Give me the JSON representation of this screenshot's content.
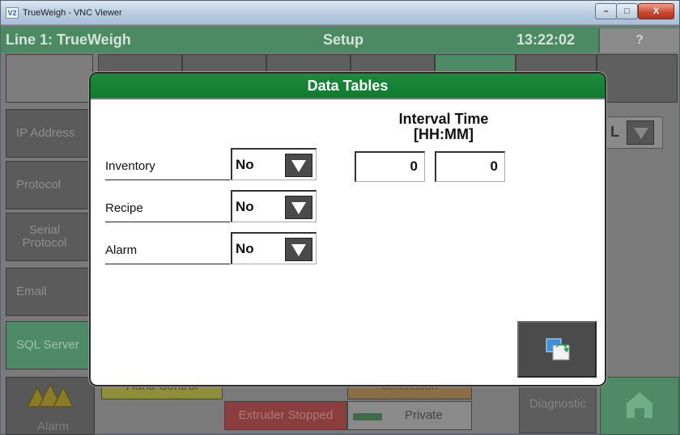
{
  "window": {
    "title": "TrueWeigh - VNC Viewer",
    "logo_text": "V2",
    "controls": {
      "minimize": "–",
      "maximize": "□",
      "close": "X"
    }
  },
  "header": {
    "line_title": "Line 1: TrueWeigh",
    "screen_title": "Setup",
    "time": "13:22:02",
    "help_label": "?"
  },
  "sidebar": {
    "items": [
      {
        "label": "IP Address",
        "active": false
      },
      {
        "label": "Protocol",
        "active": false
      },
      {
        "label": "Serial Protocol",
        "active": false
      },
      {
        "label": "Email",
        "active": false
      },
      {
        "label": "SQL Server",
        "active": true
      }
    ]
  },
  "background_field": {
    "value_fragment": "L"
  },
  "modal": {
    "title": "Data Tables",
    "interval_heading_line1": "Interval Time",
    "interval_heading_line2": "[HH:MM]",
    "rows": [
      {
        "label": "Inventory",
        "value": "No"
      },
      {
        "label": "Recipe",
        "value": "No"
      },
      {
        "label": "Alarm",
        "value": "No"
      }
    ],
    "interval_hours": "0",
    "interval_minutes": "0",
    "save_icon": "save-apply-icon"
  },
  "footer": {
    "alarm_label": "Alarm",
    "hand_control": "Hand Control",
    "extruder_status": "Extruder Stopped",
    "simulation": "Simulation",
    "private": "Private",
    "diagnostic": "Diagnostic",
    "home_icon": "home-icon"
  },
  "colors": {
    "header_green": "#4c8a64",
    "modal_title_green": "#1d8a3c",
    "active_sidebar": "#4f8a68"
  }
}
